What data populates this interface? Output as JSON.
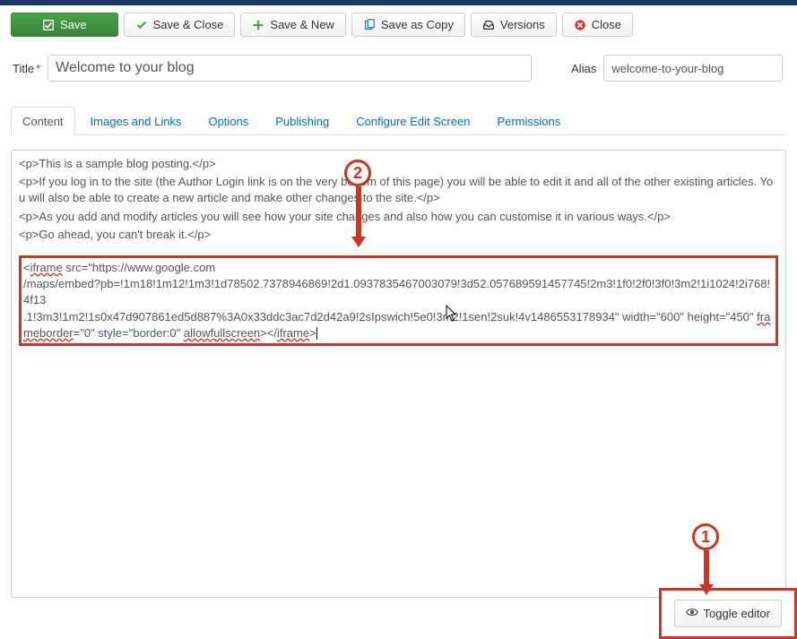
{
  "toolbar": {
    "save": "Save",
    "save_close": "Save & Close",
    "save_new": "Save & New",
    "save_copy": "Save as Copy",
    "versions": "Versions",
    "close": "Close"
  },
  "form": {
    "title_label": "Title",
    "title_required": "*",
    "title_value": "Welcome to your blog",
    "alias_label": "Alias",
    "alias_value": "welcome-to-your-blog"
  },
  "tabs": [
    {
      "id": "content",
      "label": "Content",
      "active": true
    },
    {
      "id": "images",
      "label": "Images and Links",
      "active": false
    },
    {
      "id": "options",
      "label": "Options",
      "active": false
    },
    {
      "id": "publishing",
      "label": "Publishing",
      "active": false
    },
    {
      "id": "configure",
      "label": "Configure Edit Screen",
      "active": false
    },
    {
      "id": "permissions",
      "label": "Permissions",
      "active": false
    }
  ],
  "editor": {
    "lines_plain": [
      "<p>This is a sample blog posting.</p>",
      "<p>If you log in to the site (the Author Login link is on the very bottom of this page) you will be able to edit it and all of the other existing articles. You will also be able to create a new article and make other changes to the site.</p>",
      "<p>As you add and modify articles you will see how your site changes and also how you can customise it in various ways.</p>",
      "<p>Go ahead, you can't break it.</p>"
    ],
    "iframe_pre": "<",
    "iframe_word1": "iframe",
    "iframe_mid1": " src=\"https://www.google.com",
    "iframe_line2a": "/maps/embed?pb=!1m18!1m12!1m3!1d78502.7378946869!2d1.0937835467003079!3d52.05768959145774",
    "iframe_line2b": "5!2m3!1f0!2f0!3f0!3m2!1i1024!2i768!4f13",
    "iframe_line3": ".1!3m3!1m2!1s0x47d907861ed5d887%3A0x33ddc3ac7d2d42a9!2sIpswich!5e0!3m2!1sen!2suk!4v1486553178934\" width=\"600\" height=\"450\" ",
    "iframe_word2": "frameborder",
    "iframe_mid2": "=\"0\" style=\"border:0\" ",
    "iframe_word3": "allowfullscreen",
    "iframe_mid3": "></",
    "iframe_word4": "iframe",
    "iframe_end": ">"
  },
  "toggle_editor_label": "Toggle editor",
  "callouts": {
    "one": "1",
    "two": "2"
  }
}
